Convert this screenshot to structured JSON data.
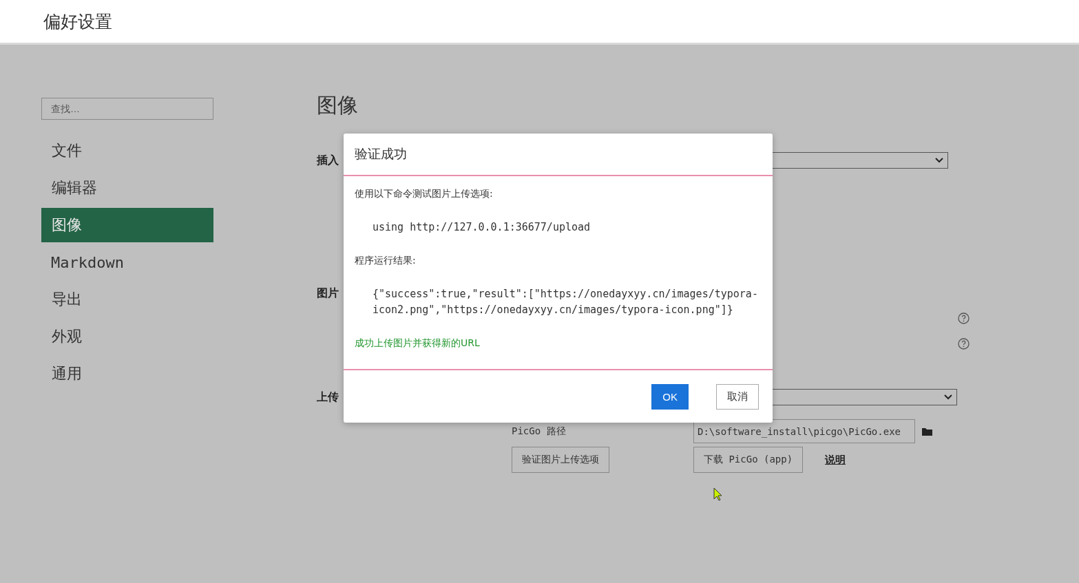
{
  "window": {
    "title": "偏好设置"
  },
  "sidebar": {
    "search": {
      "placeholder": "查找…"
    },
    "items": [
      {
        "label": "文件",
        "selected": false,
        "kind": "cjk"
      },
      {
        "label": "编辑器",
        "selected": false,
        "kind": "cjk"
      },
      {
        "label": "图像",
        "selected": true,
        "kind": "cjk"
      },
      {
        "label": "Markdown",
        "selected": false,
        "kind": "latin"
      },
      {
        "label": "导出",
        "selected": false,
        "kind": "cjk"
      },
      {
        "label": "外观",
        "selected": false,
        "kind": "cjk"
      },
      {
        "label": "通用",
        "selected": false,
        "kind": "cjk"
      }
    ]
  },
  "content": {
    "heading": "图像",
    "insert_label": "插入",
    "image_label": "图片",
    "upload_label": "上传",
    "picgo_label": "PicGo 路径",
    "picgo_path": "D:\\software_install\\picgo\\PicGo.exe",
    "verify_button": "验证图片上传选项",
    "download_button": "下载 PicGo (app)",
    "help_link": "说明"
  },
  "dialog": {
    "title": "验证成功",
    "lines": [
      {
        "kind": "text",
        "text": "使用以下命令测试图片上传选项:"
      },
      {
        "kind": "code",
        "text": "using http://127.0.0.1:36677/upload"
      },
      {
        "kind": "text",
        "text": "程序运行结果:"
      },
      {
        "kind": "code",
        "text": "{\"success\":true,\"result\":[\"https://onedayxyy.cn/images/typora-icon2.png\",\"https://onedayxyy.cn/images/typora-icon.png\"]}"
      },
      {
        "kind": "success",
        "text": "成功上传图片并获得新的URL"
      }
    ],
    "buttons": [
      {
        "label": "OK",
        "kind": "primary"
      },
      {
        "label": "取消",
        "kind": "secondary"
      }
    ]
  }
}
